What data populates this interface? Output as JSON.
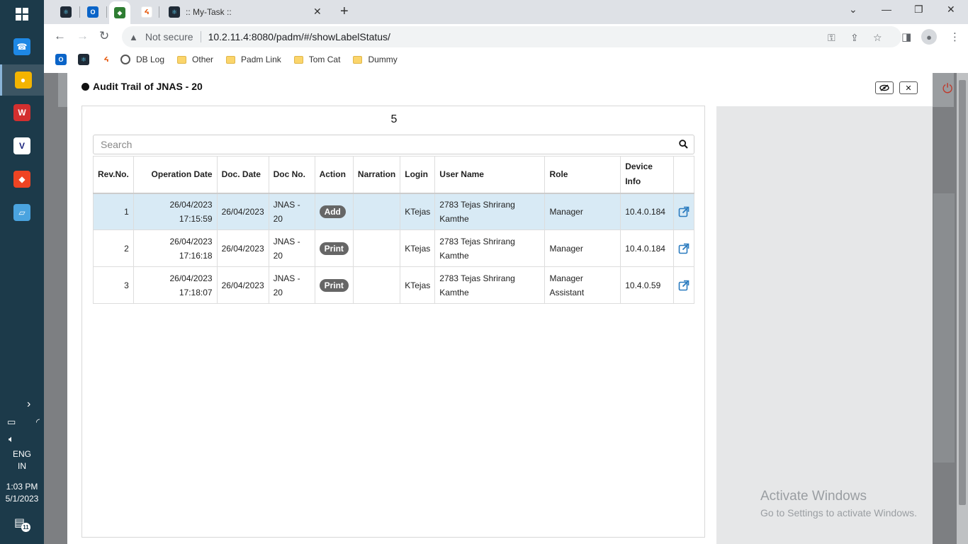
{
  "taskbar": {
    "apps": [
      {
        "name": "phone",
        "color": "#1e88e5",
        "glyph": "☎"
      },
      {
        "name": "chrome",
        "color": "#f4b400",
        "glyph": "●"
      },
      {
        "name": "wps",
        "color": "#d32f2f",
        "glyph": "W"
      },
      {
        "name": "vnc",
        "color": "#ffffff",
        "glyph": "V"
      },
      {
        "name": "anydesk",
        "color": "#ef4423",
        "glyph": "◆"
      },
      {
        "name": "app-blue",
        "color": "#4aa3df",
        "glyph": "▱"
      }
    ],
    "language": "ENG",
    "region": "IN",
    "time": "1:03 PM",
    "date": "5/1/2023",
    "notification_count": "11"
  },
  "browser": {
    "tab_title": ":: My-Task ::",
    "security_label": "Not secure",
    "url": "10.2.11.4:8080/padm/#/showLabelStatus/",
    "bookmarks": [
      {
        "label": "DB Log",
        "type": "globe"
      },
      {
        "label": "Other",
        "type": "folder"
      },
      {
        "label": "Padm Link",
        "type": "folder"
      },
      {
        "label": "Tom Cat",
        "type": "folder"
      },
      {
        "label": "Dummy",
        "type": "folder"
      }
    ]
  },
  "modal": {
    "title": "Audit Trail of JNAS - 20",
    "record_count": "5",
    "search_placeholder": "Search",
    "columns": [
      "Rev.No.",
      "Operation Date",
      "Doc. Date",
      "Doc No.",
      "Action",
      "Narration",
      "Login",
      "User Name",
      "Role",
      "Device Info",
      ""
    ],
    "rows": [
      {
        "rev": "1",
        "op_date": "26/04/2023",
        "op_time": "17:15:59",
        "doc_date": "26/04/2023",
        "doc_no": "JNAS - 20",
        "action": "Add",
        "narration": "",
        "login": "KTejas",
        "user": "2783 Tejas Shrirang Kamthe",
        "role": "Manager",
        "device": "10.4.0.184"
      },
      {
        "rev": "2",
        "op_date": "26/04/2023",
        "op_time": "17:16:18",
        "doc_date": "26/04/2023",
        "doc_no": "JNAS - 20",
        "action": "Print",
        "narration": "",
        "login": "KTejas",
        "user": "2783 Tejas Shrirang Kamthe",
        "role": "Manager",
        "device": "10.4.0.184"
      },
      {
        "rev": "3",
        "op_date": "26/04/2023",
        "op_time": "17:18:07",
        "doc_date": "26/04/2023",
        "doc_no": "JNAS - 20",
        "action": "Print",
        "narration": "",
        "login": "KTejas",
        "user": "2783 Tejas Shrirang Kamthe",
        "role": "Manager Assistant",
        "device": "10.4.0.59"
      }
    ]
  },
  "watermark": {
    "line1": "Activate Windows",
    "line2": "Go to Settings to activate Windows."
  }
}
